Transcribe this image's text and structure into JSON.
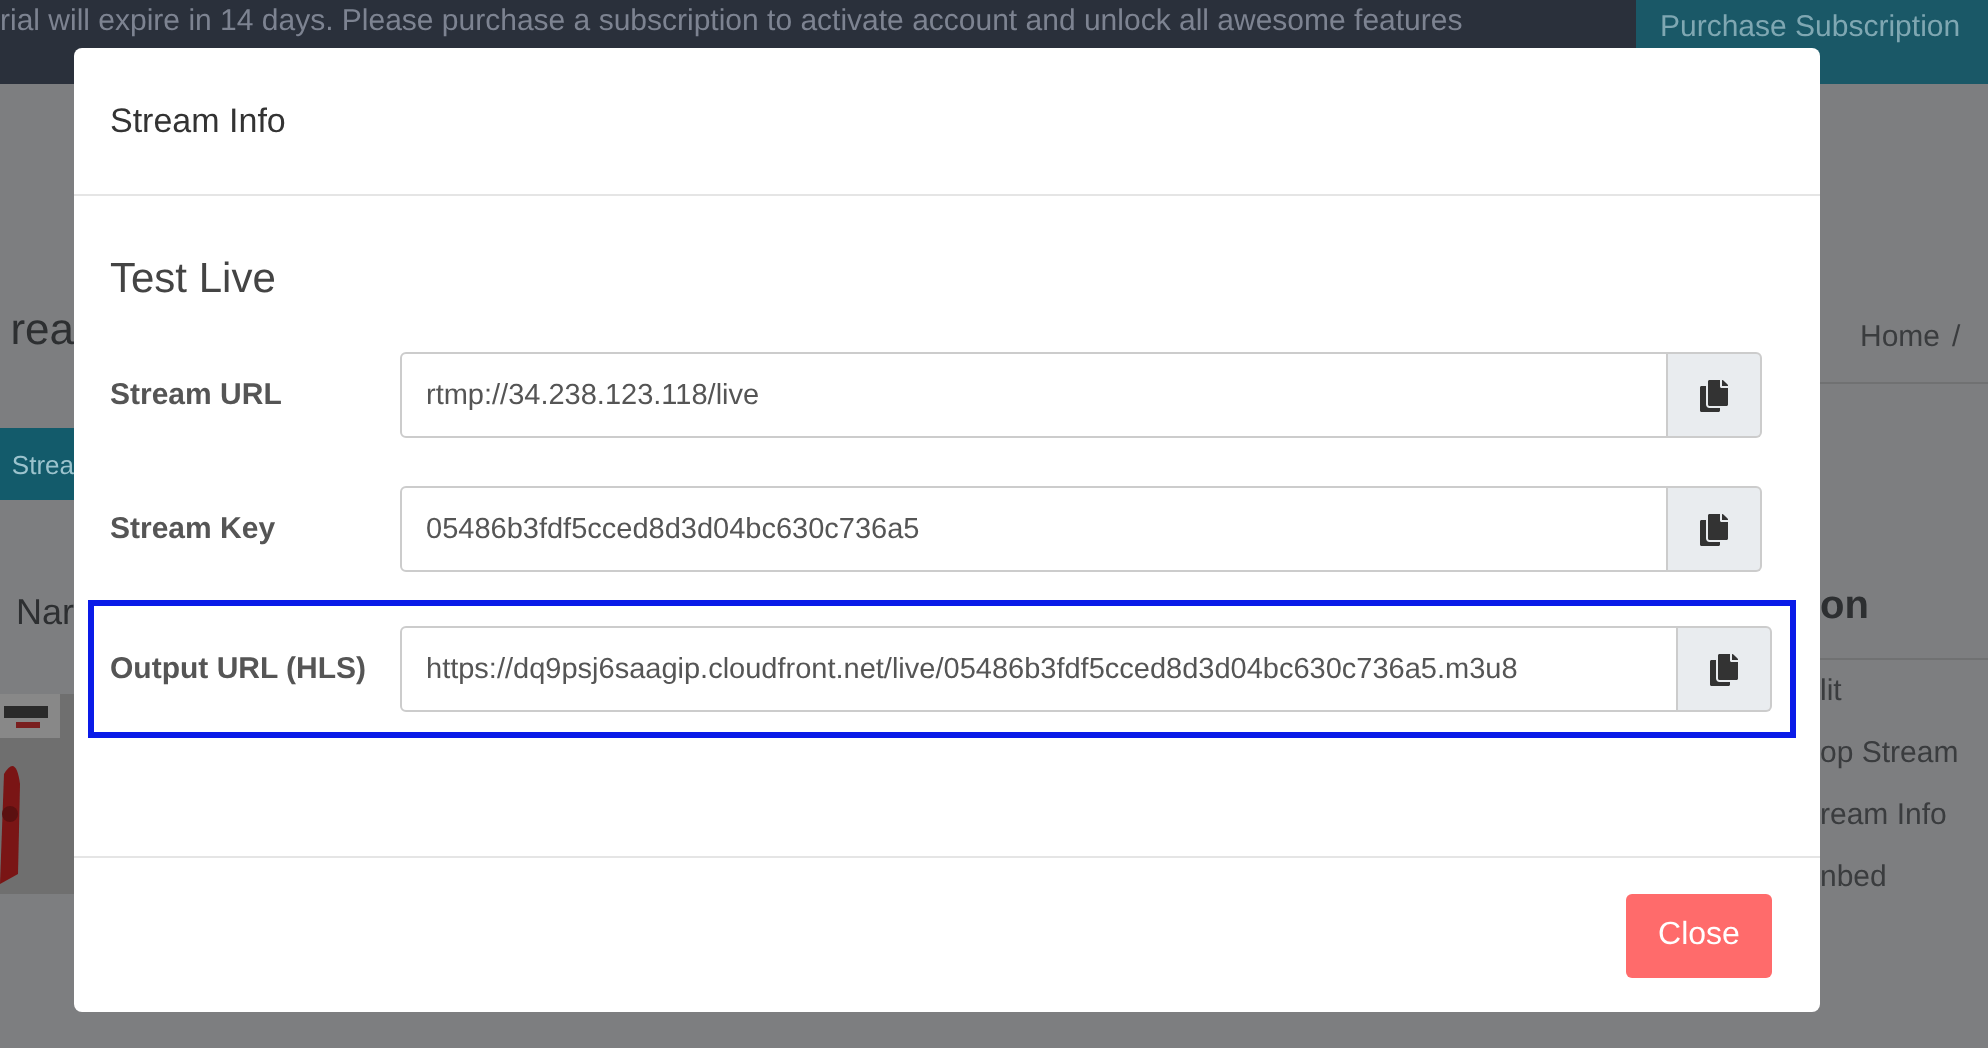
{
  "background": {
    "notice": "rial will expire in 14 days. Please purchase a subscription to activate account and unlock all awesome features",
    "purchase_button": "Purchase Subscription",
    "left": {
      "title": "rea",
      "button": "Strea",
      "column": "Nar"
    },
    "right": {
      "breadcrumb": "Home",
      "separator": "/",
      "column": "on",
      "actions": [
        "lit",
        "op Stream",
        "ream Info",
        "nbed"
      ]
    }
  },
  "modal": {
    "title": "Stream Info",
    "heading": "Test Live",
    "fields": [
      {
        "label": "Stream URL",
        "value": "rtmp://34.238.123.118/live",
        "highlighted": false
      },
      {
        "label": "Stream Key",
        "value": "05486b3fdf5cced8d3d04bc630c736a5",
        "highlighted": false
      },
      {
        "label": "Output URL (HLS)",
        "value": "https://dq9psj6saagip.cloudfront.net/live/05486b3fdf5cced8d3d04bc630c736a5.m3u8",
        "highlighted": true
      }
    ],
    "close_button": "Close"
  }
}
